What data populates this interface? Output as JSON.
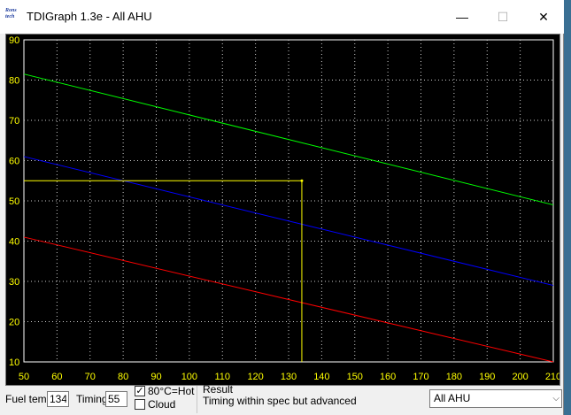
{
  "window": {
    "app_icon_text": "Rons tech",
    "title": "TDIGraph 1.3e - All AHU",
    "minimize_glyph": "—",
    "maximize_glyph": "☐",
    "close_glyph": "✕"
  },
  "chart_data": {
    "type": "line",
    "x_ticks": [
      "50",
      "60",
      "70",
      "80",
      "90",
      "100",
      "110",
      "120",
      "130",
      "140",
      "150",
      "160",
      "170",
      "180",
      "190",
      "200",
      "210"
    ],
    "y_ticks": [
      "10",
      "20",
      "30",
      "40",
      "50",
      "60",
      "70",
      "80",
      "90"
    ],
    "xlim": [
      50,
      210
    ],
    "ylim": [
      10,
      90
    ],
    "grid": true,
    "grid_style": "dotted",
    "background": "#000000",
    "series": [
      {
        "color": "#00ff00",
        "points": [
          [
            50,
            81.5
          ],
          [
            210,
            49
          ]
        ]
      },
      {
        "color": "#0000ff",
        "points": [
          [
            50,
            61
          ],
          [
            210,
            29
          ]
        ]
      },
      {
        "color": "#ff0000",
        "points": [
          [
            50,
            41
          ],
          [
            210,
            10
          ]
        ]
      }
    ],
    "marker": {
      "color": "#ffff00",
      "x": 134,
      "y": 55
    }
  },
  "controls": {
    "fuel_temp_label": "Fuel temp",
    "fuel_temp_value": "134",
    "timing_label": "Timing",
    "timing_value": "55",
    "hot_label": "80°C=Hot",
    "hot_checked_glyph": "✓",
    "cloud_label": "Cloud",
    "result_label": "Result",
    "result_text": "Timing within spec but advanced",
    "combo_value": "All AHU",
    "combo_arrow": "⌵"
  }
}
